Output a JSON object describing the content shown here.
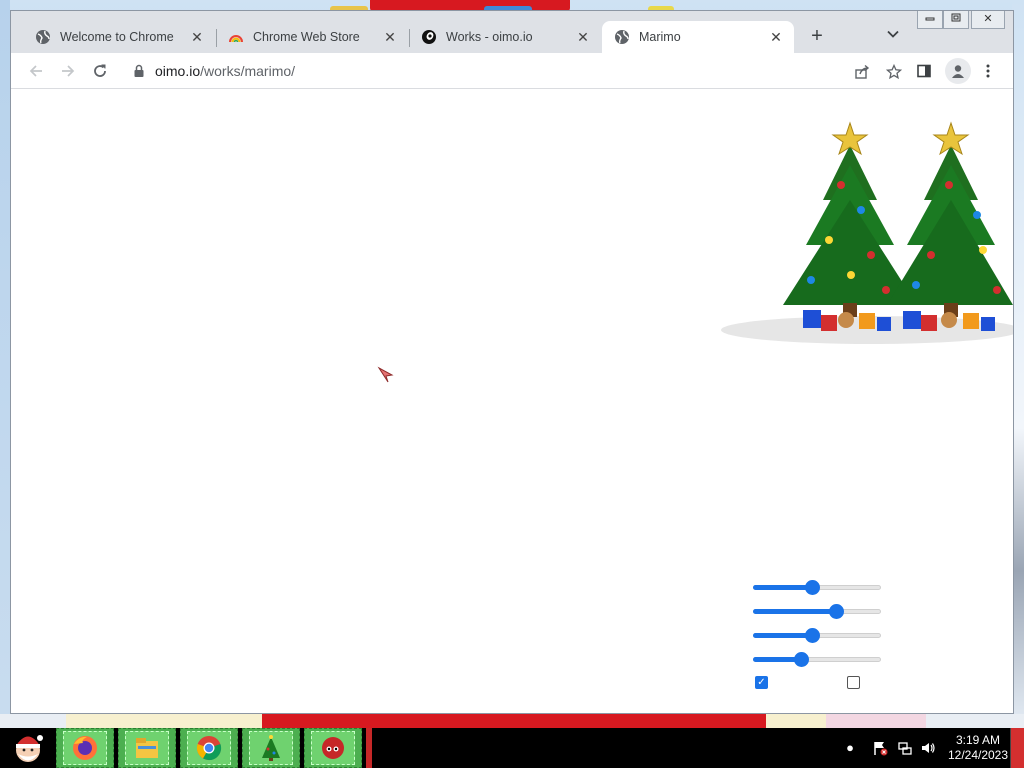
{
  "browser": {
    "tabs": [
      {
        "title": "Welcome to Chrome",
        "icon": "globe-icon",
        "active": false
      },
      {
        "title": "Chrome Web Store",
        "icon": "rainbow-icon",
        "active": false
      },
      {
        "title": "Works - oimo.io",
        "icon": "oimo-icon",
        "active": false
      },
      {
        "title": "Marimo",
        "icon": "globe-icon",
        "active": true
      }
    ],
    "new_tab_label": "+",
    "address": {
      "host": "oimo.io",
      "path": "/works/marimo/"
    }
  },
  "page": {
    "sliders": [
      {
        "name": "slider-1",
        "value": 0.46
      },
      {
        "name": "slider-2",
        "value": 0.67
      },
      {
        "name": "slider-3",
        "value": 0.46
      },
      {
        "name": "slider-4",
        "value": 0.36
      }
    ],
    "checkboxes": [
      {
        "name": "checkbox-1",
        "checked": true
      },
      {
        "name": "checkbox-2",
        "checked": false
      }
    ]
  },
  "taskbar": {
    "apps": [
      "firefox-icon",
      "file-explorer-icon",
      "chrome-icon",
      "christmas-tree-icon",
      "red-ball-icon"
    ],
    "clock": {
      "time": "3:19 AM",
      "date": "12/24/2023"
    }
  },
  "colors": {
    "accent": "#1a73e8",
    "tabstrip": "#dee1e6",
    "taskbar_app": "#4caf50"
  }
}
